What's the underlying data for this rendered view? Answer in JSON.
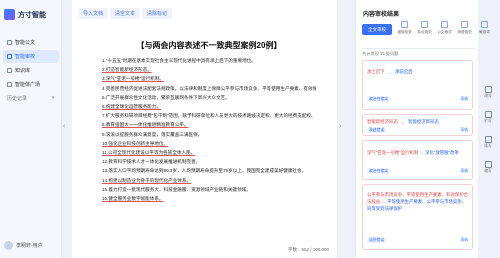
{
  "brand": {
    "name": "方寸智能"
  },
  "sidebar": {
    "items": [
      {
        "label": "智能公文"
      },
      {
        "label": "智能审校"
      },
      {
        "label": "知识库"
      },
      {
        "label": "智能体广场"
      }
    ],
    "history_label": "历史记录",
    "user_name": "李明轩-用户"
  },
  "tabs": [
    {
      "label": "导入文档"
    },
    {
      "label": "清空文本"
    },
    {
      "label": "清除标记"
    }
  ],
  "document": {
    "title": "【与两会内容表述不一致典型案例20例】",
    "lines": [
      "1.“十五五”时期在基本实现社会主义现代化进程中具有承上启下的重要地位。",
      "2.打造智能新经济形态。",
      "3.深气“亚泥一号楼”运行机制。",
      "4.完善民营经济促进法配套法规政策。以法律和制度上保障公平参与市场竞争、平等使用生产要素、有效保护合法权益。",
      "5.广泛开展群众性文化活动，繁荣互联网条件下新兴大众文艺。",
      "6.构建全球化运营服务能力。",
      "7.扩大服务科研项目经费“包干制”范围，赋予科研单位和人员更大的技术路线决定权、更大的经费支配权、更大的资源调度权。",
      "8.教育强国大一一体化推进精准教育公平。",
      "9.滚滚以提服务群众满意度，落实覆盖三满医保。",
      "10.强化企业科技创新主导地位。",
      "11.公司全现代化建设以平等为各族全体人民。",
      "12.教育科学技术人才一体化发展推进机制完善。",
      "13.落实人口平均预期寿命达到80.3岁，人均预期寿命提升至79岁以上，我国完全建成美好健康社会。",
      "14.构建以制造业为骨干的现代化产业体系。",
      "15.着力打造一批现代服务大，科技金融服、资源领域产业链和关键领域。",
      "16.健全服务业数字赋能体系。"
    ],
    "word_count": "字数：552 / 100,000"
  },
  "panel": {
    "title": "内容审校结果",
    "mode_button": "全文审校",
    "tools": [
      "错误检查",
      "标点规范",
      "公文格式",
      "用语规范",
      "敏感词"
    ],
    "stats": "共计发现 15 处问题",
    "cards": [
      {
        "orig": "承上启下",
        "sugg": "承前启后",
        "tag": "政治性错误",
        "action": "采纳"
      },
      {
        "orig": "智能新经济形态",
        "sugg": "智能经济新形态",
        "tag": "表述错误",
        "action": "采纳"
      },
      {
        "orig": "深气“亚泥一号楼”运行机制",
        "sugg": "深化“放管服”改革",
        "tag": "政治性错误",
        "action": "采纳"
      },
      {
        "orig": "公平参与市场竞争、平等使用生产要素、有效保护合法权益",
        "sugg": "平等使用生产要素、公平参与市场竞争、同等受到法律保护",
        "tag": "语序错误",
        "action": "采纳"
      }
    ]
  },
  "edge_tools": [
    "改写",
    "扩写",
    "续写",
    "缩写"
  ]
}
